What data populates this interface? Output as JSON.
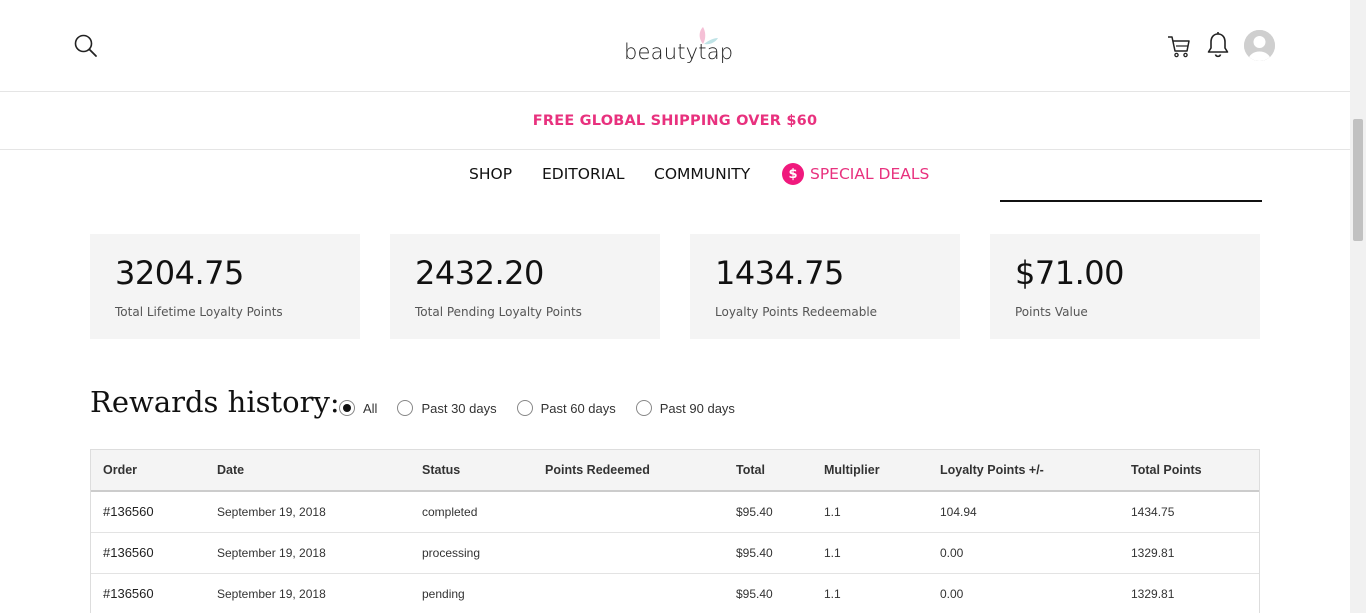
{
  "header": {
    "logo_text": "beautytap",
    "icons": [
      "search-icon",
      "cart-icon",
      "bell-icon",
      "avatar-icon"
    ]
  },
  "promo": {
    "text": "FREE GLOBAL SHIPPING OVER $60"
  },
  "nav": {
    "items": [
      {
        "label": "SHOP"
      },
      {
        "label": "EDITORIAL"
      },
      {
        "label": "COMMUNITY"
      },
      {
        "label": "SPECIAL DEALS",
        "icon_glyph": "$"
      }
    ]
  },
  "stats": [
    {
      "value": "3204.75",
      "label": "Total Lifetime Loyalty Points"
    },
    {
      "value": "2432.20",
      "label": "Total Pending Loyalty Points"
    },
    {
      "value": "1434.75",
      "label": "Loyalty Points Redeemable"
    },
    {
      "value": "$71.00",
      "label": "Points Value"
    }
  ],
  "rewards": {
    "title": "Rewards history:",
    "filters": [
      {
        "label": "All",
        "selected": true
      },
      {
        "label": "Past 30 days",
        "selected": false
      },
      {
        "label": "Past 60 days",
        "selected": false
      },
      {
        "label": "Past 90 days",
        "selected": false
      }
    ],
    "columns": [
      "Order",
      "Date",
      "Status",
      "Points Redeemed",
      "Total",
      "Multiplier",
      "Loyalty Points +/-",
      "Total Points"
    ],
    "rows": [
      {
        "order": "#136560",
        "date": "September 19, 2018",
        "status": "completed",
        "redeemed": "",
        "total": "$95.40",
        "multiplier": "1.1",
        "delta": "104.94",
        "total_points": "1434.75"
      },
      {
        "order": "#136560",
        "date": "September 19, 2018",
        "status": "processing",
        "redeemed": "",
        "total": "$95.40",
        "multiplier": "1.1",
        "delta": "0.00",
        "total_points": "1329.81"
      },
      {
        "order": "#136560",
        "date": "September 19, 2018",
        "status": "pending",
        "redeemed": "",
        "total": "$95.40",
        "multiplier": "1.1",
        "delta": "0.00",
        "total_points": "1329.81"
      }
    ]
  },
  "colors": {
    "accent": "#e8317e",
    "card_bg": "#f4f4f4",
    "table_header_bg": "#f4f4f4"
  }
}
